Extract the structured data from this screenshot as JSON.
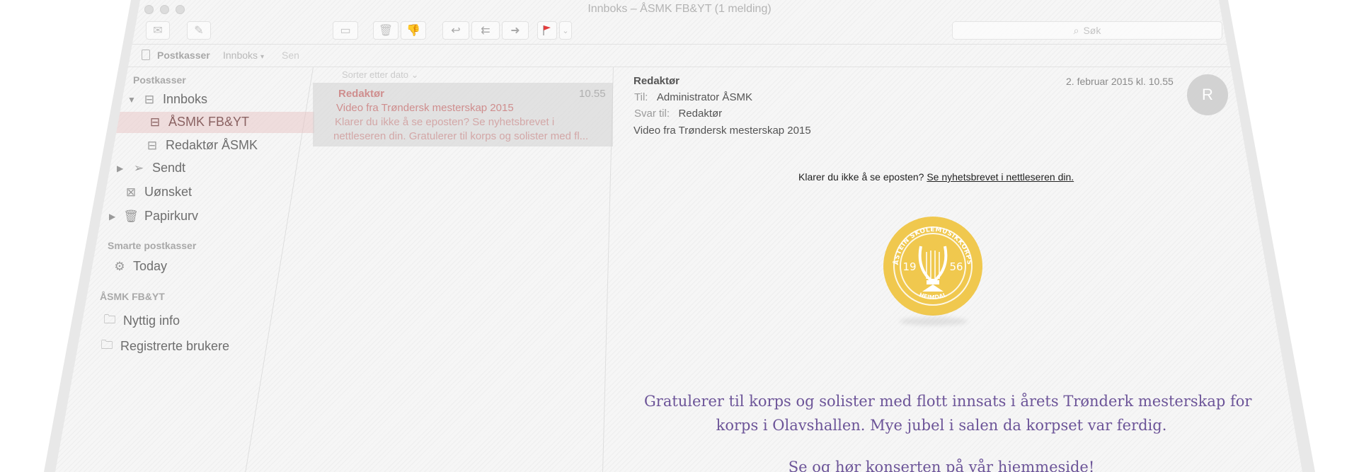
{
  "window": {
    "title": "Innboks – ÅSMK FB&YT (1 melding)"
  },
  "toolbar": {
    "search_placeholder": "Søk",
    "flag_color": "#e23c3c"
  },
  "favorites_bar": {
    "mailboxes": "Postkasser",
    "inbox": "Innboks",
    "sent": "Sen"
  },
  "sidebar": {
    "mailboxes_header": "Postkasser",
    "inbox": "Innboks",
    "inbox_children": [
      "ÅSMK FB&YT",
      "Redaktør ÅSMK"
    ],
    "sent": "Sendt",
    "junk": "Uønsket",
    "trash": "Papirkurv",
    "smart_header": "Smarte postkasser",
    "today": "Today",
    "account_header": "ÅSMK FB&YT",
    "folders": [
      "Nyttig info",
      "Registrerte brukere"
    ]
  },
  "message_list": {
    "sort_label": "Sorter etter dato",
    "messages": [
      {
        "from": "Redaktør",
        "time": "10.55",
        "subject": "Video fra Trøndersk mesterskap 2015",
        "preview_line1": "Klarer du ikke å se eposten? Se nyhetsbrevet i",
        "preview_line2": "nettleseren din. Gratulerer til korps og solister med fl..."
      }
    ]
  },
  "reading_pane": {
    "from": "Redaktør",
    "date": "2. februar 2015 kl. 10.55",
    "to_label": "Til:",
    "to_value": "Administrator ÅSMK",
    "reply_label": "Svar til:",
    "reply_value": "Redaktør",
    "subject": "Video fra Trøndersk mesterskap 2015",
    "avatar_letter": "R",
    "newsletter": {
      "browser_prompt": "Klarer du ikke å se eposten?",
      "browser_link": "Se nyhetsbrevet i nettleseren din.",
      "logo": {
        "ring_text": "ÅSTEIN SKOLEMUSIKKORPS",
        "year_left": "19",
        "year_right": "56",
        "bottom_text": "HEIMDAL",
        "color": "#f0c84e"
      },
      "body_line1": "Gratulerer til korps og solister med flott innsats i årets Trønderk mesterskap for",
      "body_line2": "korps i Olavshallen. Mye jubel i salen da korpset var ferdig.",
      "body_line3": "Se og hør konserten på vår hjemmeside!"
    }
  }
}
